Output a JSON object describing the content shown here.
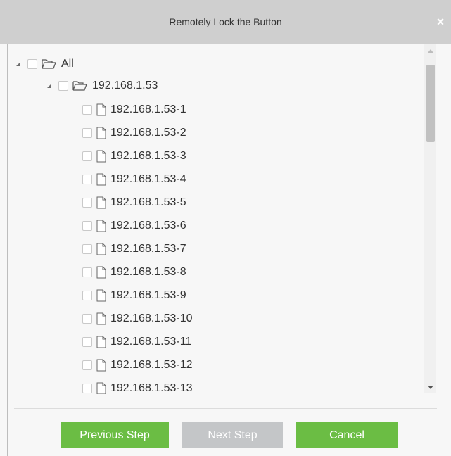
{
  "dialog": {
    "title": "Remotely Lock the Button",
    "close_symbol": "×"
  },
  "tree": {
    "root": {
      "label": "All",
      "expanded": true,
      "checked": false,
      "icon": "folder-open-icon"
    },
    "group": {
      "label": "192.168.1.53",
      "expanded": true,
      "checked": false,
      "icon": "folder-open-icon"
    },
    "items": [
      {
        "label": "192.168.1.53-1",
        "checked": false
      },
      {
        "label": "192.168.1.53-2",
        "checked": false
      },
      {
        "label": "192.168.1.53-3",
        "checked": false
      },
      {
        "label": "192.168.1.53-4",
        "checked": false
      },
      {
        "label": "192.168.1.53-5",
        "checked": false
      },
      {
        "label": "192.168.1.53-6",
        "checked": false
      },
      {
        "label": "192.168.1.53-7",
        "checked": false
      },
      {
        "label": "192.168.1.53-8",
        "checked": false
      },
      {
        "label": "192.168.1.53-9",
        "checked": false
      },
      {
        "label": "192.168.1.53-10",
        "checked": false
      },
      {
        "label": "192.168.1.53-11",
        "checked": false
      },
      {
        "label": "192.168.1.53-12",
        "checked": false
      },
      {
        "label": "192.168.1.53-13",
        "checked": false
      }
    ]
  },
  "buttons": {
    "previous": "Previous Step",
    "next": "Next Step",
    "cancel": "Cancel"
  },
  "colors": {
    "accent_green": "#6bbd44",
    "disabled_gray": "#c4c6c8",
    "titlebar": "#cfcfcf"
  }
}
